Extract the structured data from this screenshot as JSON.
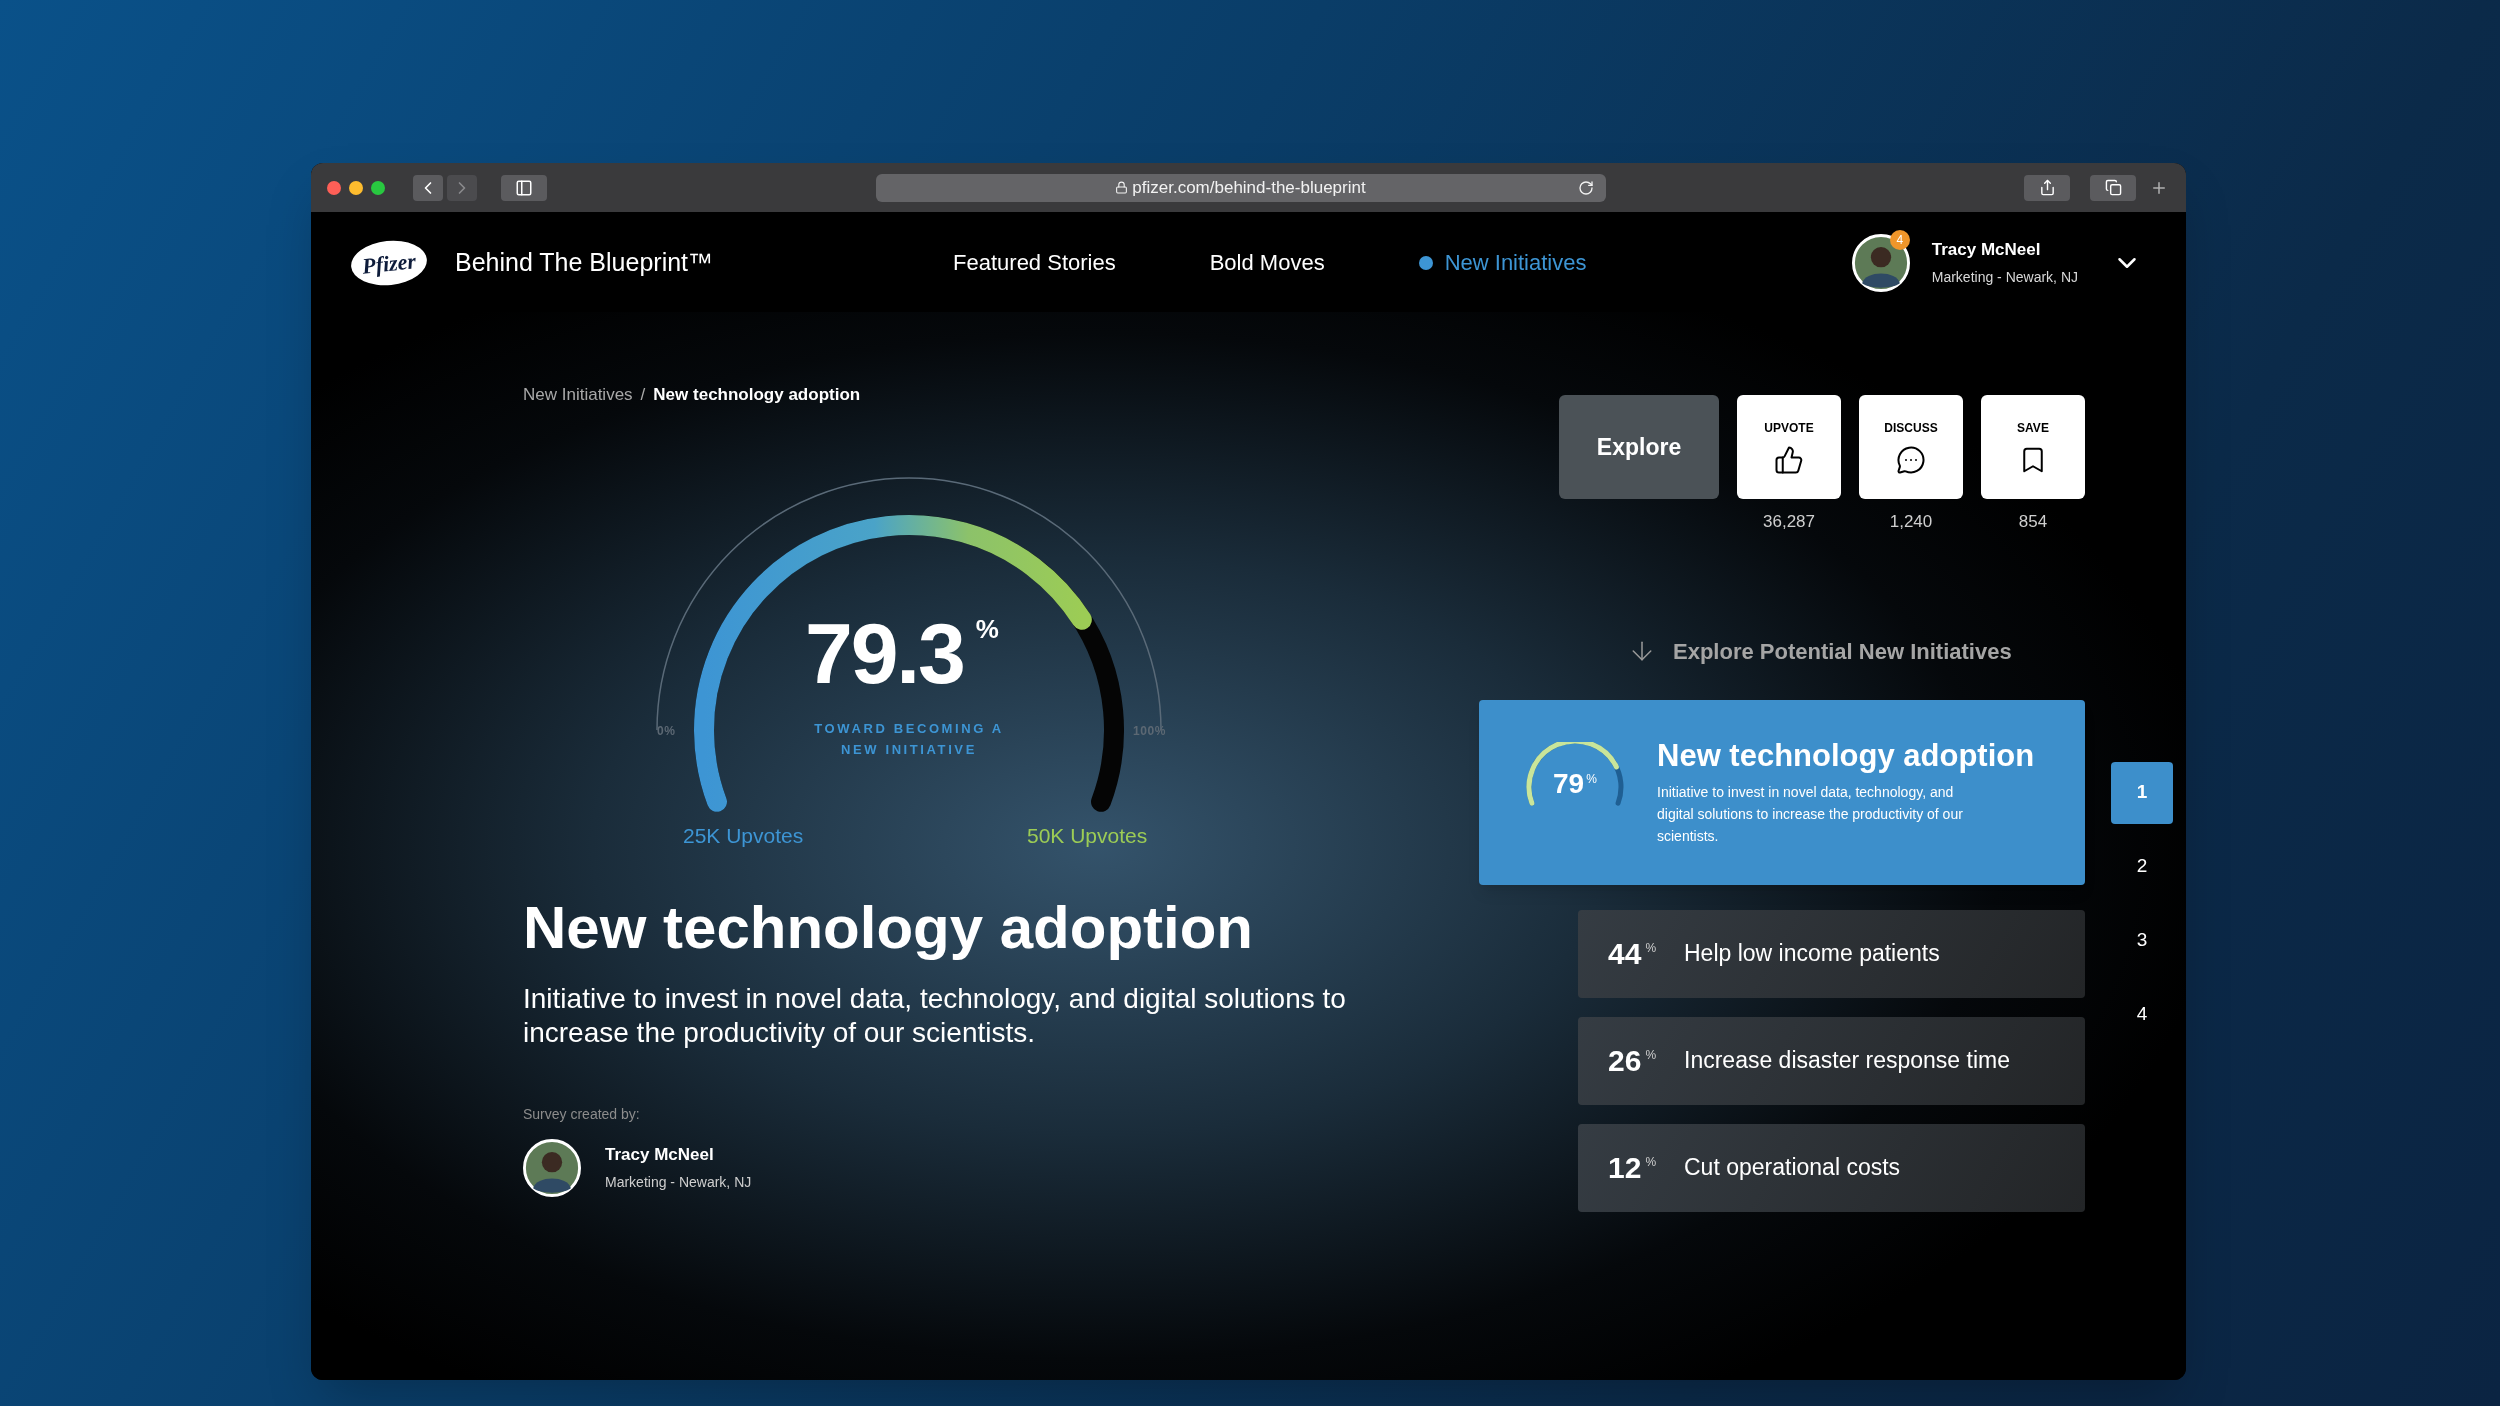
{
  "browser": {
    "url": "pfizer.com/behind-the-blueprint"
  },
  "header": {
    "logo": "Pfizer",
    "site_title": "Behind The Blueprint™",
    "nav": [
      {
        "label": "Featured Stories",
        "selected": false
      },
      {
        "label": "Bold Moves",
        "selected": false
      },
      {
        "label": "New Initiatives",
        "selected": true
      }
    ],
    "user": {
      "name": "Tracy McNeel",
      "subtitle": "Marketing - Newark, NJ",
      "badge": "4"
    }
  },
  "breadcrumb": [
    {
      "label": "New Initiatives",
      "current": false
    },
    {
      "label": "New technology adoption",
      "current": true
    }
  ],
  "breadcrumb_separator": "/",
  "gauge": {
    "value": "79.3",
    "unit": "%",
    "caption": "TOWARD BECOMING A NEW INITIATIVE",
    "min_label": "0%",
    "max_label": "100%",
    "start_label": "25K Upvotes",
    "end_label": "50K Upvotes"
  },
  "title": "New technology adoption",
  "description": "Initiative to invest in novel data, technology, and digital solutions to increase the productivity of our scientists.",
  "creator": {
    "label": "Survey created by:",
    "name": "Tracy McNeel",
    "subtitle": "Marketing - Newark, NJ"
  },
  "actions": {
    "explore": "Explore",
    "buttons": [
      {
        "kind": "upvote",
        "label": "UPVOTE",
        "count": "36,287"
      },
      {
        "kind": "discuss",
        "label": "DISCUSS",
        "count": "1,240"
      },
      {
        "kind": "save",
        "label": "SAVE",
        "count": "854"
      }
    ]
  },
  "list_heading": "Explore Potential New Initiatives",
  "initiatives": [
    {
      "percent": "79",
      "unit": "%",
      "title": "New technology adoption",
      "description": "Initiative to invest in novel data, technology, and digital solutions to increase the productivity of our scientists.",
      "selected": true
    },
    {
      "percent": "44",
      "unit": "%",
      "title": "Help low income patients",
      "selected": false
    },
    {
      "percent": "26",
      "unit": "%",
      "title": "Increase disaster response time",
      "selected": false
    },
    {
      "percent": "12",
      "unit": "%",
      "title": "Cut operational costs",
      "selected": false
    }
  ],
  "pager": [
    {
      "label": "1",
      "selected": true
    },
    {
      "label": "2",
      "selected": false
    },
    {
      "label": "3",
      "selected": false
    },
    {
      "label": "4",
      "selected": false
    }
  ]
}
